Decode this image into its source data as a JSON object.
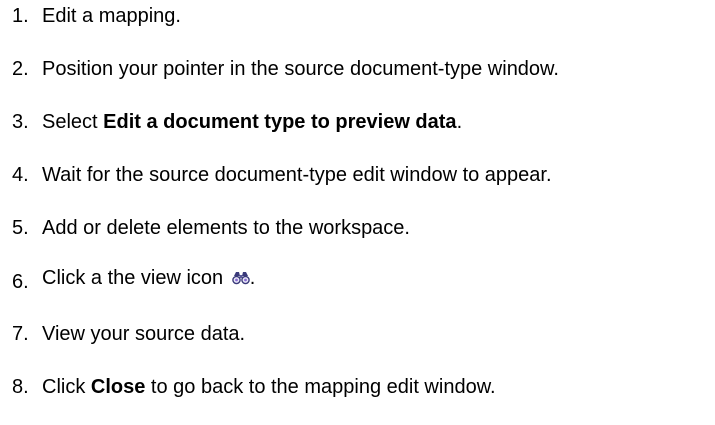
{
  "steps": [
    {
      "number": "1.",
      "text": "Edit a mapping."
    },
    {
      "number": "2.",
      "text": "Position your pointer in the source document-type window."
    },
    {
      "number": "3.",
      "prefix": "Select ",
      "bold": "Edit a document type to preview data",
      "suffix": "."
    },
    {
      "number": "4.",
      "text": "Wait for the source document-type edit window to appear."
    },
    {
      "number": "5.",
      "text": "Add or delete elements to the workspace."
    },
    {
      "number": "6.",
      "prefix": "Click a the view icon ",
      "icon": "binoculars-icon",
      "suffix": "."
    },
    {
      "number": "7.",
      "text": "View your source data."
    },
    {
      "number": "8.",
      "prefix": "Click ",
      "bold": "Close",
      "suffix": " to go back to the mapping edit window."
    }
  ]
}
